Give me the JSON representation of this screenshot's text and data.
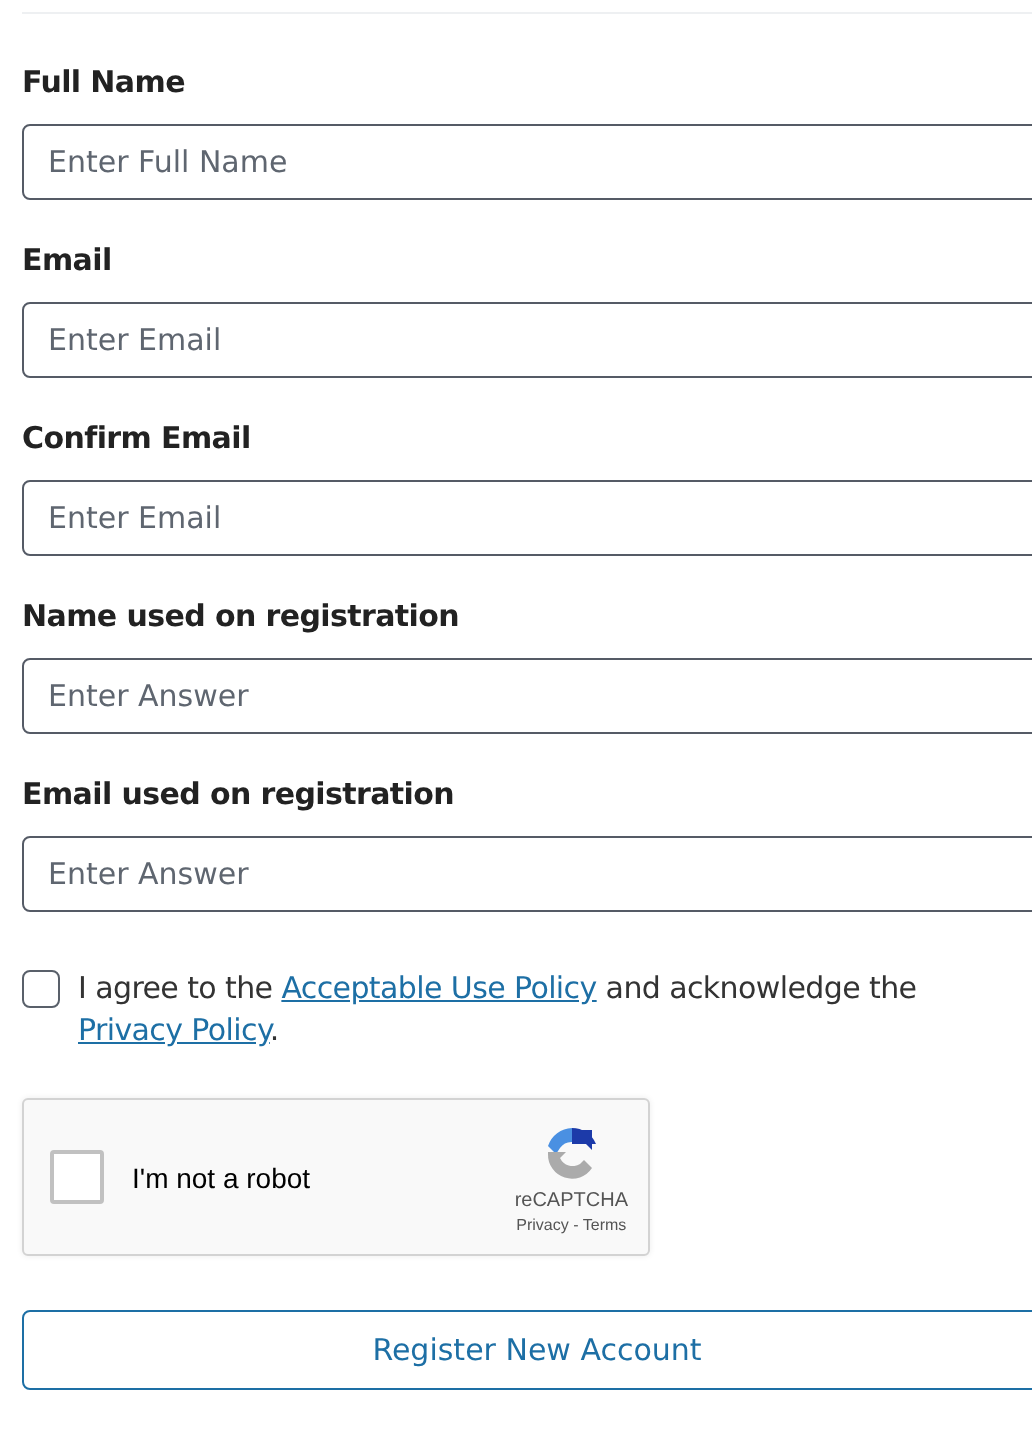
{
  "fields": [
    {
      "label": "Full Name",
      "placeholder": "Enter Full Name"
    },
    {
      "label": "Email",
      "placeholder": "Enter Email"
    },
    {
      "label": "Confirm Email",
      "placeholder": "Enter Email"
    },
    {
      "label": "Name used on registration",
      "placeholder": "Enter Answer"
    },
    {
      "label": "Email used on registration",
      "placeholder": "Enter Answer"
    }
  ],
  "agreement": {
    "checked": false,
    "parts": [
      {
        "kind": "text",
        "text": "I agree to the"
      },
      {
        "kind": "link",
        "text": "Acceptable Use Policy"
      },
      {
        "kind": "text",
        "text": "and acknowledge the"
      },
      {
        "kind": "link",
        "text": "Privacy Policy",
        "suffix": "."
      }
    ]
  },
  "captcha": {
    "checked": false,
    "label": "I'm not a robot",
    "brand": "reCAPTCHA",
    "privacy": "Privacy",
    "separator": "-",
    "terms": "Terms"
  },
  "submit": "Register New Account"
}
